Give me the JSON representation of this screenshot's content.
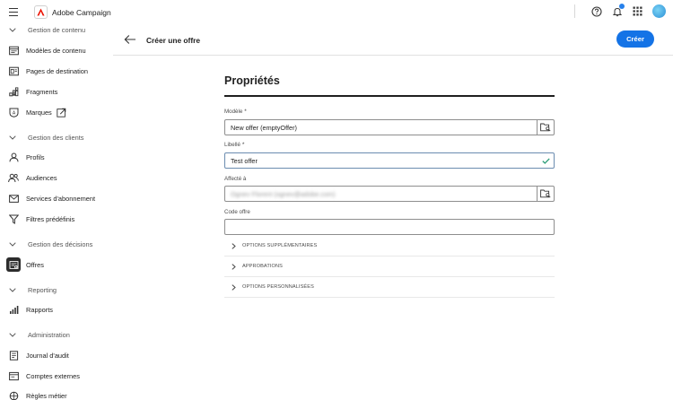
{
  "app": {
    "name": "Adobe Campaign"
  },
  "colors": {
    "accent": "#1473e6",
    "active_bg": "#2c2c2c",
    "notification_dot": "#2680eb"
  },
  "topbar": {
    "icons": [
      "help-icon",
      "bell-icon",
      "apps-grid-icon",
      "avatar"
    ]
  },
  "sidebar": {
    "sections": [
      {
        "label": "Gestion de contenu",
        "items": [
          "Modèles de contenu",
          "Pages de destination",
          "Fragments",
          "Marques"
        ]
      },
      {
        "label": "Gestion des clients",
        "items": [
          "Profils",
          "Audiences",
          "Services d'abonnement",
          "Filtres prédéfinis"
        ]
      },
      {
        "label": "Gestion des décisions",
        "items": [
          "Offres"
        ]
      },
      {
        "label": "Reporting",
        "items": [
          "Rapports"
        ]
      },
      {
        "label": "Administration",
        "items": [
          "Journal d'audit",
          "Comptes externes",
          "Règles métier"
        ]
      }
    ],
    "active_item": "Offres"
  },
  "header": {
    "title": "Créer une offre",
    "create_label": "Créer"
  },
  "form": {
    "title": "Propriétés",
    "model_label": "Modèle",
    "model_value": "New offer (emptyOffer)",
    "label_label": "Libellé",
    "label_value": "Test offer",
    "assigned_label": "Affecté à",
    "assigned_value": "Ognev Florent (ognev@adobe.com)",
    "code_label": "Code offre",
    "code_value": "",
    "required_marker": "*",
    "sections": [
      "OPTIONS SUPPLÉMENTAIRES",
      "APPROBATIONS",
      "OPTIONS PERSONNALISÉES"
    ]
  }
}
